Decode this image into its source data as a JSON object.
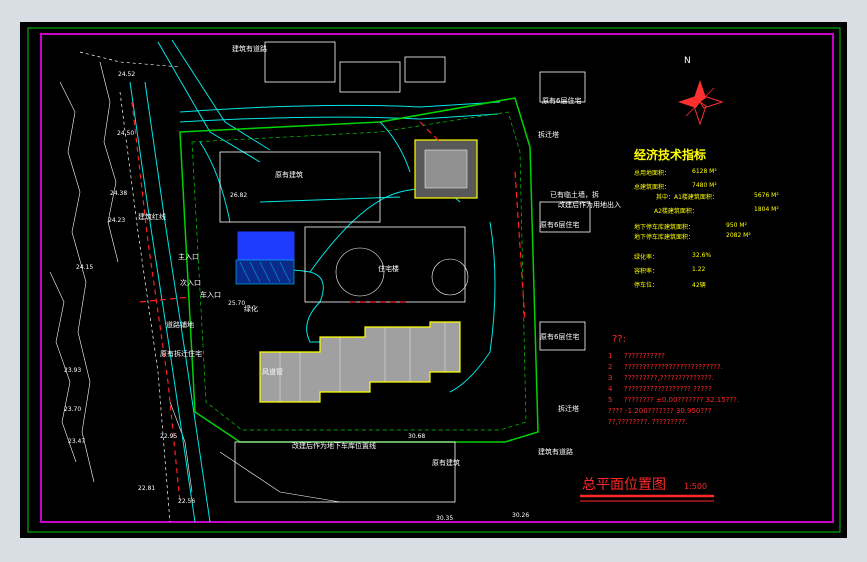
{
  "drawing": {
    "title": "总平面位置图",
    "scale": "1:500",
    "colors": {
      "background": "#000000",
      "frame": "#c800c8",
      "road": "#00e6e6",
      "boundary": "#00d200",
      "title": "#ff2828",
      "info": "#ffff00",
      "building_fill": "#a0a0a0",
      "highlight": "#ffff00",
      "blue_block": "#1e3cff"
    }
  },
  "north_arrow": {
    "label": "N",
    "icon": "north-arrow-icon"
  },
  "tech_table": {
    "title": "经济技术指标",
    "rows": [
      {
        "label": "总用地面积：",
        "value": "6128 M²"
      },
      {
        "label": "总建筑面积：",
        "value": "7480 M²"
      },
      {
        "label": "其中：A1楼建筑面积：",
        "value": "5676 M²"
      },
      {
        "label": "A2楼建筑面积：",
        "value": "1804 M²"
      },
      {
        "label": "地下停车库建筑面积：",
        "value": "950 M²"
      },
      {
        "label": "地下停车库建筑面积：",
        "value": "2082 M²"
      },
      {
        "label": "绿化率：",
        "value": "32.6%"
      },
      {
        "label": "容积率：",
        "value": "1.22"
      },
      {
        "label": "停车位：",
        "value": "42辆"
      }
    ]
  },
  "notes": {
    "title": "??:",
    "items": [
      {
        "num": "1",
        "text": "???????????"
      },
      {
        "num": "2",
        "text": "??????????????????????????."
      },
      {
        "num": "3",
        "text": "?????????,??????????????."
      },
      {
        "num": "4",
        "text": "?????????????????? ?????"
      },
      {
        "num": "5",
        "text": "???????? ±0.00??????? 32.15???."
      },
      {
        "num": "",
        "text": "???? -1.200??????? 30.950???"
      },
      {
        "num": "",
        "text": "??,????????. ?????????."
      }
    ]
  },
  "site_labels": {
    "road_top": "建筑有道路",
    "road_bottom": "建筑有道路",
    "residential_ne": "原有6层住宅",
    "residential_e1": "原有6层住宅",
    "residential_e2": "原有6层住宅",
    "residential_e3": "原有6层住宅",
    "residential_w": "原有拆迁住宅",
    "building_top": "原有建筑",
    "building_bottom": "原有建筑",
    "existing_tower_1": "拆迁塔",
    "existing_tower_2": "拆迁塔",
    "road_red": "建筑红线",
    "gate_main": "主入口",
    "gate_2": "次入口",
    "gate_3": "车入口",
    "greenery": "绿化",
    "residence_mid": "住宅楼",
    "pavement": "道路铺地",
    "vent": "风道管",
    "note_demolish": "已有临土墙，拆",
    "note_demolish_2": "改建后作为用地出入",
    "bottom_note": "改建后作为地下车库位置线",
    "elev_1": "24.52",
    "elev_2": "24.50",
    "elev_3": "24.38",
    "elev_4": "24.23",
    "elev_5": "24.15",
    "elev_6": "23.93",
    "elev_7": "23.70",
    "elev_8": "23.47",
    "elev_9": "22.95",
    "elev_10": "22.81",
    "elev_11": "22.56",
    "elev_12": "30.35",
    "elev_13": "30.26",
    "elev_14": "30.68",
    "elev_15": "25.70",
    "elev_16": "26.82"
  }
}
